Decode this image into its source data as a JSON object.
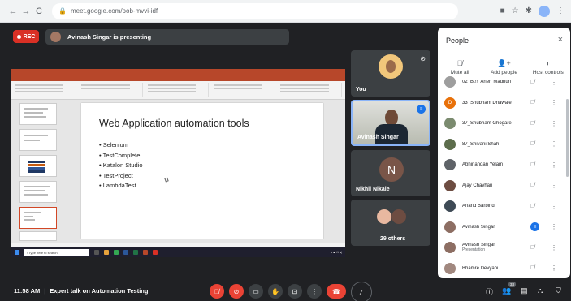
{
  "browser": {
    "url": "meet.google.com/pob-mvvi-idf",
    "back": "←",
    "forward": "→",
    "reload": "C"
  },
  "meet": {
    "rec_label": "REC",
    "presenting_text": "Avinash Singar is presenting"
  },
  "slide": {
    "title": "Web Application automation tools",
    "bullets": [
      "Selenium",
      "TestComplete",
      "Katalon Studio",
      "TestProject",
      "LambdaTest"
    ]
  },
  "taskbar": {
    "search_placeholder": "Type here to search"
  },
  "tiles": {
    "you": "You",
    "presenter": "Avinash Singar",
    "nikhil_initial": "N",
    "nikhil": "Nikhil Nikale",
    "others": "29 others"
  },
  "people_panel": {
    "title": "People",
    "close_icon": "×",
    "actions": {
      "mute_all": "Mute all",
      "add_people": "Add people",
      "host_controls": "Host controls"
    },
    "participants": [
      {
        "name": "02_Bt!!_Aher_Madhuri",
        "initial": "",
        "color": "#9e9e9e",
        "sub": ""
      },
      {
        "name": "33_Shubham Dhawale",
        "initial": "D",
        "color": "#e8710a",
        "sub": ""
      },
      {
        "name": "37_Shubham Ghogare",
        "initial": "",
        "color": "#7b8b6f",
        "sub": ""
      },
      {
        "name": "87_Shivani Shah",
        "initial": "",
        "color": "#5d6d4c",
        "sub": ""
      },
      {
        "name": "Abhinandan Yelam",
        "initial": "",
        "color": "#5f6368",
        "sub": ""
      },
      {
        "name": "Ajay Chavhan",
        "initial": "",
        "color": "#6d4c41",
        "sub": ""
      },
      {
        "name": "Anand Barbind",
        "initial": "",
        "color": "#3e4a55",
        "sub": ""
      },
      {
        "name": "Avinash Singar",
        "initial": "",
        "color": "#8d6e63",
        "sub": ""
      },
      {
        "name": "Avinash Singar",
        "initial": "",
        "color": "#8d6e63",
        "sub": "Presentation"
      },
      {
        "name": "Bhamre Devyani",
        "initial": "",
        "color": "#a1887f",
        "sub": ""
      }
    ]
  },
  "bottom_bar": {
    "time": "11:58 AM",
    "separator": "|",
    "meeting_title": "Expert talk on Automation Testing",
    "participant_count": "33"
  },
  "colors": {
    "meet_bg": "#202124",
    "tile_bg": "#3c4043",
    "rec_red": "#d93025",
    "accent_blue": "#1a73e8",
    "ppt_accent": "#b7472a"
  }
}
